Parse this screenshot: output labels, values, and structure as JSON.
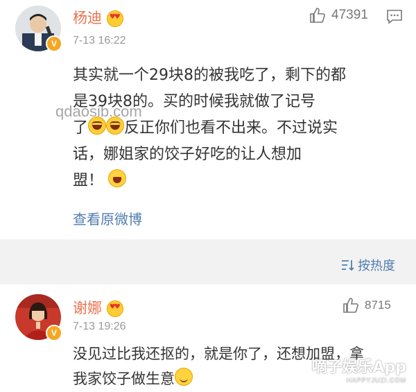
{
  "post": {
    "author": "杨迪",
    "time": "7-13 16:22",
    "like_count": "47391",
    "content_lines": [
      "其实就一个29块8的被我吃了，剩下的都",
      "是39块8的。买的时候我就做了记号",
      "反正你们也看不出来。不过说实",
      "话，娜姐家的饺子好吃的让人想加",
      "盟！"
    ],
    "content_line3_prefix": "了",
    "view_original_label": "查看原微博",
    "verified_badge": "V"
  },
  "sort": {
    "label": "按热度"
  },
  "comment": {
    "author": "谢娜",
    "time": "7-13 19:26",
    "like_count": "8715",
    "content_lines": [
      "没见过比我还抠的，就是你了，还想加盟，拿",
      "我家饺子做生意"
    ],
    "verified_badge": "V"
  },
  "watermarks": {
    "top": "qdaosib.com",
    "brand": "嘀子娱乐App",
    "brand_sub": "HAPPYJUZI.COM"
  },
  "colors": {
    "username": "#eb7350",
    "link": "#507daf",
    "divider_bg": "#f2f2f2",
    "verified": "#f5a623"
  },
  "icons": {
    "like": "thumbs-up-icon",
    "comment": "comment-icon",
    "sort": "sort-icon"
  }
}
